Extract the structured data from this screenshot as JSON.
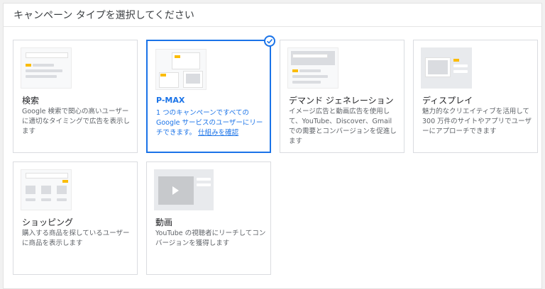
{
  "header": {
    "title": "キャンペーン タイプを選択してください"
  },
  "cards": [
    {
      "id": "search",
      "label": "検索",
      "desc": "Google 検索で関心の高いユーザーに適切なタイミングで広告を表示します",
      "selected": false
    },
    {
      "id": "pmax",
      "label": "P-MAX",
      "desc": "1 つのキャンペーンですべての Google サービスのユーザーにリーチできます。",
      "link": "仕組みを確認",
      "selected": true
    },
    {
      "id": "demand",
      "label": "デマンド ジェネレーション",
      "desc": "イメージ広告と動画広告を使用して、YouTube、Discover、Gmail での需要とコンバージョンを促進します",
      "selected": false
    },
    {
      "id": "display",
      "label": "ディスプレイ",
      "desc": "魅力的なクリエイティブを活用して 300 万件のサイトやアプリでユーザーにアプローチできます",
      "selected": false
    },
    {
      "id": "shopping",
      "label": "ショッピング",
      "desc": "購入する商品を探しているユーザーに商品を表示します",
      "selected": false
    },
    {
      "id": "video",
      "label": "動画",
      "desc": "YouTube の視聴者にリーチしてコンバージョンを獲得します",
      "selected": false
    }
  ],
  "icons": {
    "check": "check-circle-icon",
    "play": "play-icon"
  },
  "colors": {
    "accent": "#1a73e8",
    "yellow": "#fbbc04",
    "border": "#dadce0"
  }
}
